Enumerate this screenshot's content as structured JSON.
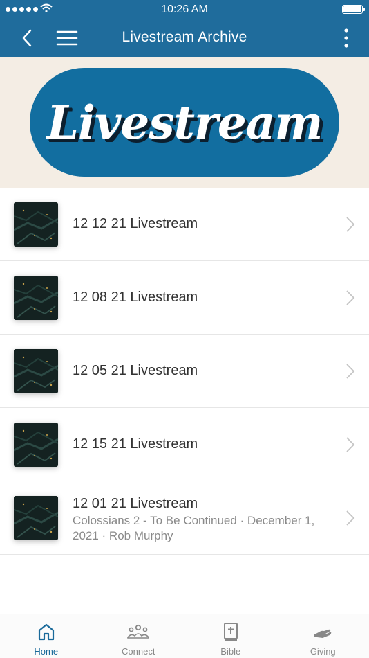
{
  "status_bar": {
    "time": "10:26 AM"
  },
  "nav": {
    "title": "Livestream Archive"
  },
  "banner": {
    "text": "Livestream"
  },
  "items": [
    {
      "title": "12 12 21 Livestream",
      "subtitle": ""
    },
    {
      "title": "12 08 21 Livestream",
      "subtitle": ""
    },
    {
      "title": "12 05 21 Livestream",
      "subtitle": ""
    },
    {
      "title": "12 15 21 Livestream",
      "subtitle": ""
    },
    {
      "title": "12 01 21 Livestream",
      "subtitle": "Colossians 2 - To Be Continued · December 1, 2021 · Rob Murphy"
    }
  ],
  "tabs": [
    {
      "label": "Home",
      "icon": "home-icon",
      "active": true
    },
    {
      "label": "Connect",
      "icon": "people-icon",
      "active": false
    },
    {
      "label": "Bible",
      "icon": "bible-icon",
      "active": false
    },
    {
      "label": "Giving",
      "icon": "giving-hand-icon",
      "active": false
    }
  ],
  "colors": {
    "header": "#1f6c9c",
    "banner_bg": "#f4ede4",
    "pill": "#126ea0",
    "active_tab": "#1a6a9a",
    "inactive_tab": "#888888"
  }
}
